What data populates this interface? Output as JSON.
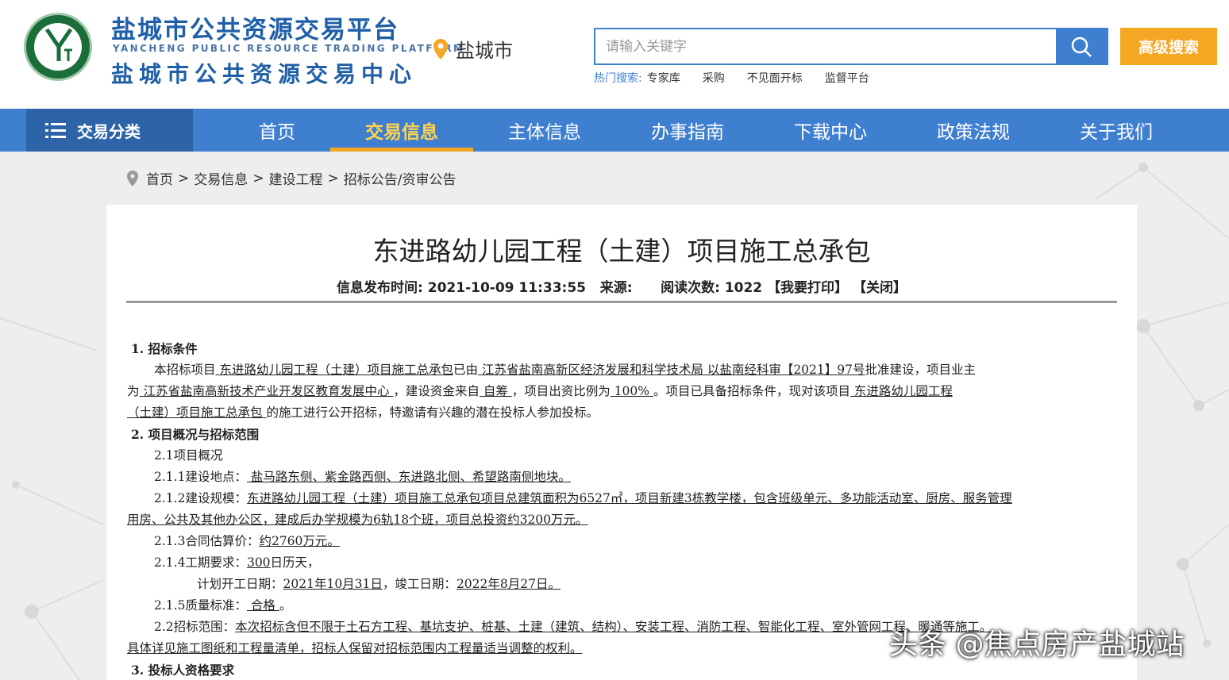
{
  "header": {
    "brand_cn": "盐城市公共资源交易平台",
    "brand_en": "YANCHENG PUBLIC RESOURCE TRADING PLATFORM",
    "brand_cn2": "盐城市公共资源交易中心",
    "city": "盐城市",
    "search_placeholder": "请输入关键字",
    "advanced_search": "高级搜索",
    "hot_label": "热门搜索:",
    "hot_keywords": [
      "专家库",
      "采购",
      "不见面开标",
      "监督平台"
    ]
  },
  "nav": {
    "category": "交易分类",
    "items": [
      "首页",
      "交易信息",
      "主体信息",
      "办事指南",
      "下载中心",
      "政策法规",
      "关于我们"
    ],
    "active": "交易信息"
  },
  "breadcrumb": [
    "首页",
    "交易信息",
    "建设工程",
    "招标公告/资审公告"
  ],
  "article": {
    "title": "东进路幼儿园工程（土建）项目施工总承包",
    "publish_label": "信息发布时间:",
    "publish_time": "2021-10-09 11:33:55",
    "source_label": "来源:",
    "read_label": "阅读次数:",
    "read_count": "1022",
    "print": "【我要打印】",
    "close": "【关闭】"
  },
  "doc": {
    "s1_title": "1.  招标条件",
    "s1_p1a": "本招标项目",
    "s1_p1b": "   东进路幼儿园工程（土建）项目施工总承包",
    "s1_p1c": "已由",
    "s1_p1d": "   江苏省盐南高新区经济发展和科学技术局  以盐南经科审【2021】97号",
    "s1_p1e": "批准建设，项目业主",
    "s1_p2a": "为",
    "s1_p2b": "   江苏省盐南高新技术产业开发区教育发展中心  ",
    "s1_p2c": "，建设资金来自",
    "s1_p2d": "   自筹    ",
    "s1_p2e": "，项目出资比例为",
    "s1_p2f": "   100%    ",
    "s1_p2g": "。项目已具备招标条件，现对该项目",
    "s1_p2h": "   东进路幼儿园工程",
    "s1_p3a": "（土建）项目施工总承包    ",
    "s1_p3b": "的施工进行公开招标，特邀请有兴趣的潜在投标人参加投标。",
    "s2_title": "2.  项目概况与招标范围",
    "s2_1": "2.1项目概况",
    "s2_1_1a": "2.1.1建设地点：",
    "s2_1_1b": "   盐马路东侧、紫金路西侧、东进路北侧、希望路南侧地块。",
    "s2_1_2a": "2.1.2建设规模：",
    "s2_1_2b": "东进路幼儿园工程（土建）项目施工总承包项目总建筑面积为6527㎡，项目新建3栋教学楼，包含班级单元、多功能活动室、厨房、服务管理",
    "s2_1_2c": "用房、公共及其他办公区，建成后办学规模为6轨18个班，项目总投资约3200万元。",
    "s2_1_3a": "2.1.3合同估算价：",
    "s2_1_3b": "约2760万元。",
    "s2_1_4a": "2.1.4工期要求：",
    "s2_1_4b": "300",
    "s2_1_4c": "日历天，",
    "s2_1_4d": "计划开工日期：",
    "s2_1_4e": "2021年10月31日",
    "s2_1_4f": "，竣工日期：",
    "s2_1_4g": "2022年8月27日。",
    "s2_1_5a": "2.1.5质量标准：",
    "s2_1_5b": "     合格    ",
    "s2_1_5c": "。",
    "s2_2a": "2.2招标范围：",
    "s2_2b": "本次招标含但不限于土石方工程、基坑支护、桩基、土建（建筑、结构）、安装工程、消防工程、智能化工程、室外管网工程、暖通等施工。",
    "s2_2c": "具体详见施工图纸和工程量清单，招标人保留对招标范围内工程量适当调整的权利。",
    "s3_title": "3.  投标人资格要求"
  },
  "watermark": "头条 @焦点房产盐城站",
  "colors": {
    "primary": "#3f7fd0",
    "nav_dark": "#2d64a8",
    "accent": "#f5a623"
  }
}
